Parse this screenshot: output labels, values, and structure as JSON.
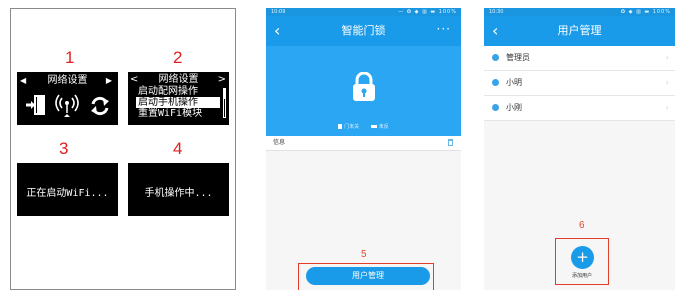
{
  "panel1": {
    "step_numbers": [
      "1",
      "2",
      "3",
      "4"
    ],
    "screen1": {
      "title": "网络设置",
      "left_arrow": "◀",
      "right_arrow": "▶"
    },
    "screen2": {
      "title": "网络设置",
      "left_arrow": "<",
      "right_arrow": ">",
      "items": [
        "启动配网操作",
        "启动手机操作",
        "重置WiFi模块"
      ],
      "selected_index": 1
    },
    "screen3": {
      "text": "正在启动WiFi..."
    },
    "screen4": {
      "text": "手机操作中..."
    }
  },
  "phone1": {
    "status_time": "10:09",
    "status_icons": "— ✪ ◆ ▥ ▬ 100%",
    "title": "智能门锁",
    "back_icon": "‹",
    "more_icon": "···",
    "legend": {
      "item1": "门未关",
      "item2": "未反"
    },
    "info_label": "信息",
    "step_number": "5",
    "user_mgmt_button": "用户管理"
  },
  "phone2": {
    "status_time": "10:30",
    "status_icons": "✪ ◆ ▥ ▬ 100%",
    "title": "用户管理",
    "back_icon": "‹",
    "users": [
      {
        "name": "管理员"
      },
      {
        "name": "小明"
      },
      {
        "name": "小刚"
      }
    ],
    "step_number": "6",
    "fab_symbol": "+",
    "fab_label": "添加用户"
  },
  "colors": {
    "primary": "#1a9bea",
    "hero": "#2aa6f2",
    "highlight_red": "#e53c2a",
    "step_red": "#e02020"
  }
}
